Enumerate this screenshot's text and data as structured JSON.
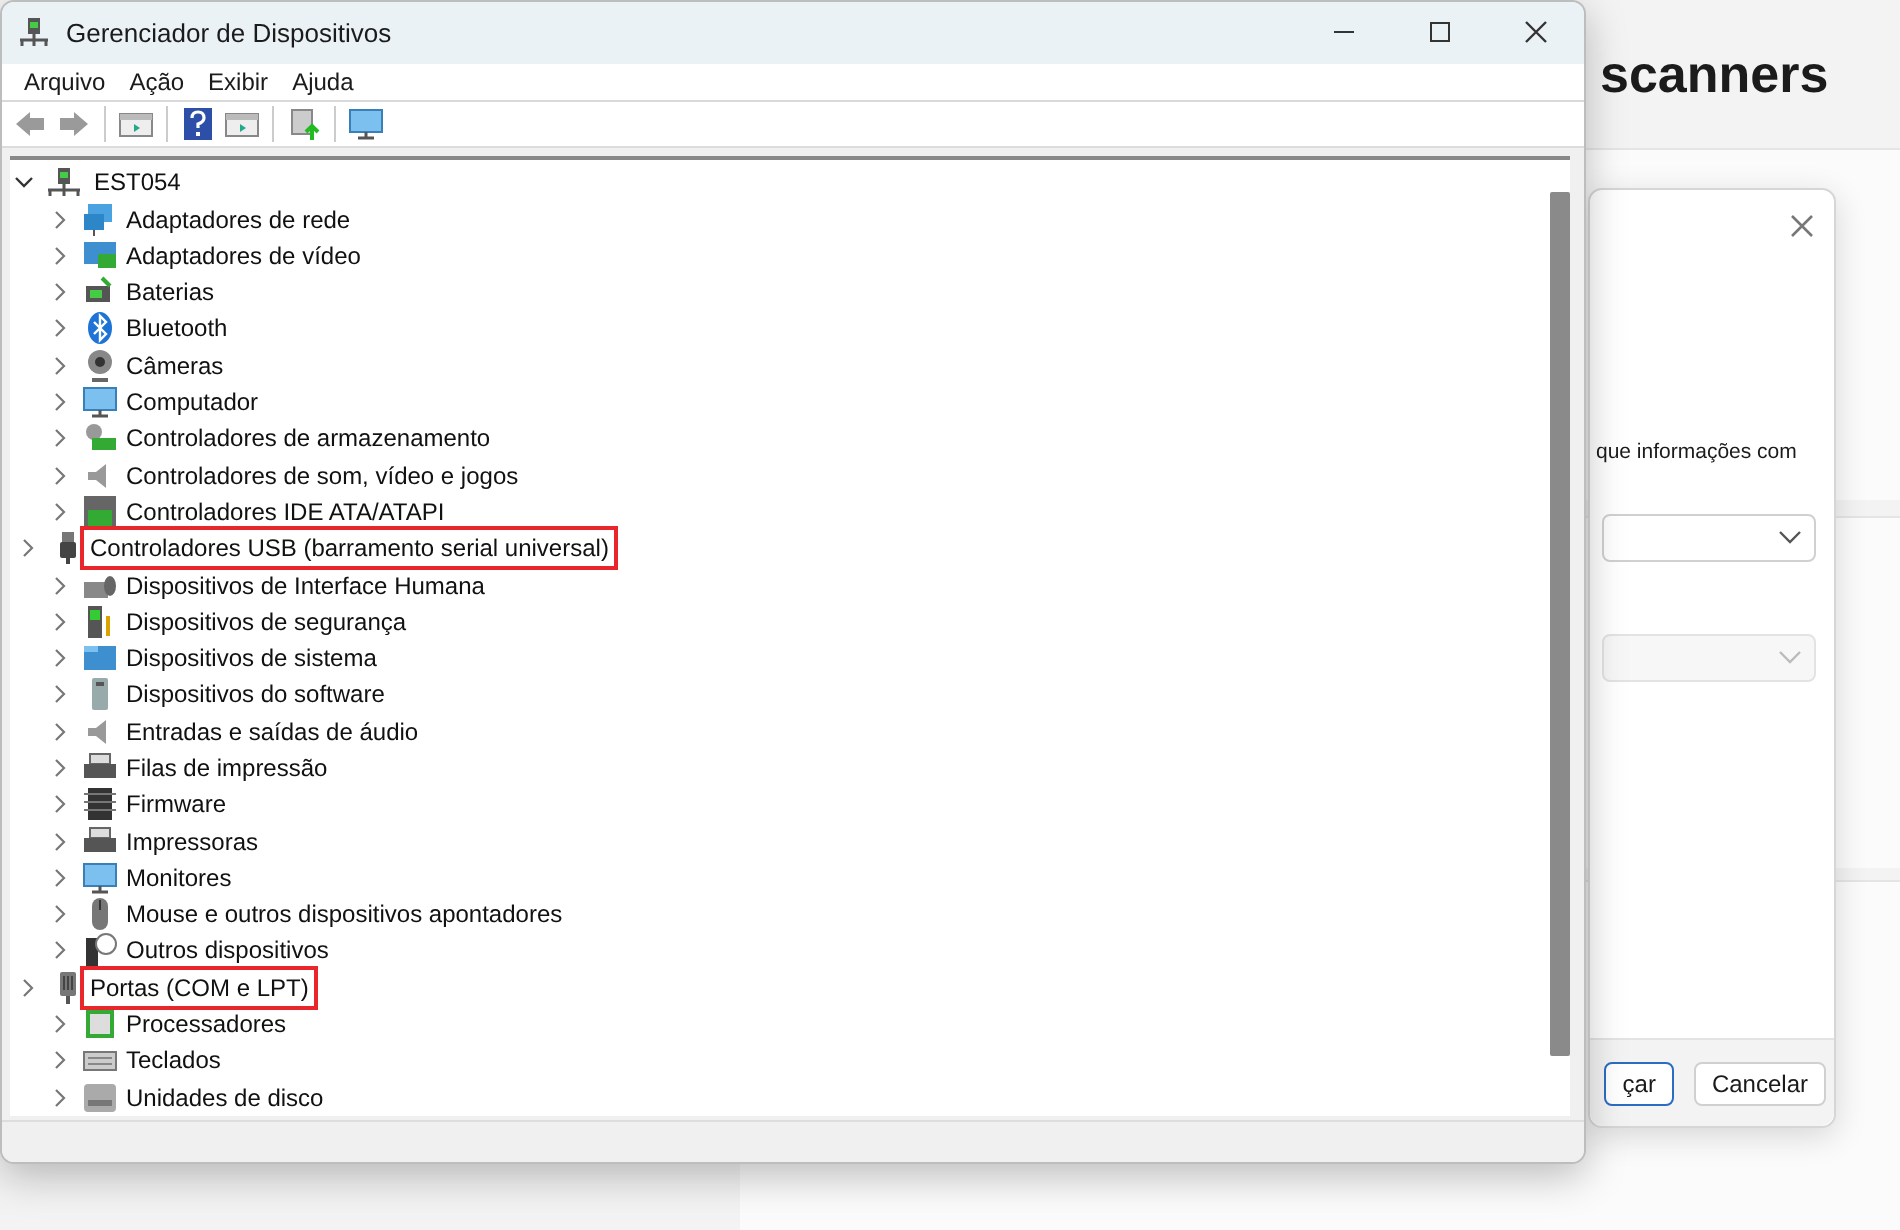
{
  "background_window": {
    "heading": "scanners",
    "dialog": {
      "text": "que informações com",
      "dropdowns": [
        {
          "disabled": false
        },
        {
          "disabled": true
        }
      ],
      "buttons": [
        {
          "label": "çar",
          "primary": true
        },
        {
          "label": "Cancelar",
          "primary": false
        }
      ]
    }
  },
  "window": {
    "title": "Gerenciador de Dispositivos"
  },
  "menu": [
    "Arquivo",
    "Ação",
    "Exibir",
    "Ajuda"
  ],
  "tree": {
    "label": "EST054",
    "expanded": true,
    "children": [
      {
        "label": "Adaptadores de rede",
        "expanded": false,
        "highlighted": false
      },
      {
        "label": "Adaptadores de vídeo",
        "expanded": false,
        "highlighted": false
      },
      {
        "label": "Baterias",
        "expanded": false,
        "highlighted": false
      },
      {
        "label": "Bluetooth",
        "expanded": false,
        "highlighted": false
      },
      {
        "label": "Câmeras",
        "expanded": false,
        "highlighted": false
      },
      {
        "label": "Computador",
        "expanded": false,
        "highlighted": false
      },
      {
        "label": "Controladores de armazenamento",
        "expanded": false,
        "highlighted": false
      },
      {
        "label": "Controladores de som, vídeo e jogos",
        "expanded": false,
        "highlighted": false
      },
      {
        "label": "Controladores IDE ATA/ATAPI",
        "expanded": false,
        "highlighted": false
      },
      {
        "label": "Controladores USB (barramento serial universal)",
        "expanded": false,
        "highlighted": true
      },
      {
        "label": "Dispositivos de Interface Humana",
        "expanded": false,
        "highlighted": false
      },
      {
        "label": "Dispositivos de segurança",
        "expanded": false,
        "highlighted": false
      },
      {
        "label": "Dispositivos de sistema",
        "expanded": false,
        "highlighted": false
      },
      {
        "label": "Dispositivos do software",
        "expanded": false,
        "highlighted": false
      },
      {
        "label": "Entradas e saídas de áudio",
        "expanded": false,
        "highlighted": false
      },
      {
        "label": "Filas de impressão",
        "expanded": false,
        "highlighted": false
      },
      {
        "label": "Firmware",
        "expanded": false,
        "highlighted": false
      },
      {
        "label": "Impressoras",
        "expanded": false,
        "highlighted": false
      },
      {
        "label": "Monitores",
        "expanded": false,
        "highlighted": false
      },
      {
        "label": "Mouse e outros dispositivos apontadores",
        "expanded": false,
        "highlighted": false
      },
      {
        "label": "Outros dispositivos",
        "expanded": false,
        "highlighted": false
      },
      {
        "label": "Portas (COM e LPT)",
        "expanded": false,
        "highlighted": true
      },
      {
        "label": "Processadores",
        "expanded": false,
        "highlighted": false
      },
      {
        "label": "Teclados",
        "expanded": false,
        "highlighted": false
      },
      {
        "label": "Unidades de disco",
        "expanded": false,
        "highlighted": false
      }
    ]
  }
}
